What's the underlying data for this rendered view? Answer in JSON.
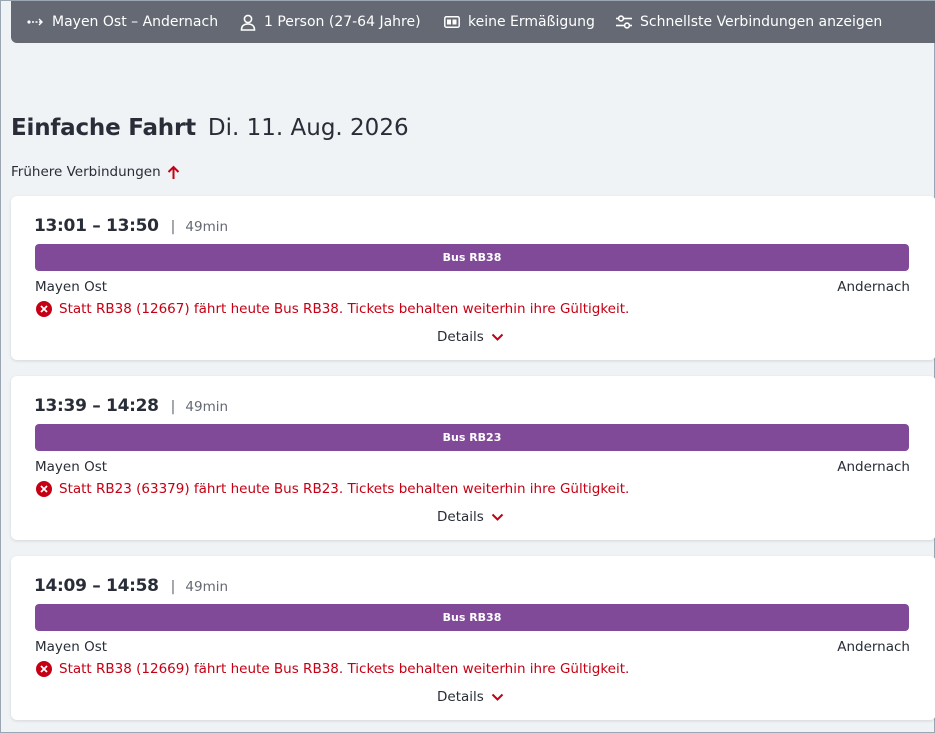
{
  "topbar": {
    "route": "Mayen Ost – Andernach",
    "travellers": "1 Person (27-64 Jahre)",
    "discount": "keine Ermäßigung",
    "filter": "Schnellste Verbindungen anzeigen"
  },
  "title": {
    "main": "Einfache Fahrt",
    "date": "Di. 11. Aug. 2026"
  },
  "earlier_label": "Frühere Verbindungen",
  "colors": {
    "accent_red": "#c50014",
    "bus_purple": "#814a98",
    "topbar_grey": "#646973"
  },
  "connections": [
    {
      "time_range": "13:01 – 13:50",
      "separator": "|",
      "duration": "49min",
      "line": "Bus RB38",
      "from": "Mayen Ost",
      "to": "Andernach",
      "notice": "Statt RB38 (12667) fährt heute Bus RB38. Tickets behalten weiterhin ihre Gültigkeit.",
      "details_label": "Details"
    },
    {
      "time_range": "13:39 – 14:28",
      "separator": "|",
      "duration": "49min",
      "line": "Bus RB23",
      "from": "Mayen Ost",
      "to": "Andernach",
      "notice": "Statt RB23 (63379) fährt heute Bus RB23. Tickets behalten weiterhin ihre Gültigkeit.",
      "details_label": "Details"
    },
    {
      "time_range": "14:09 – 14:58",
      "separator": "|",
      "duration": "49min",
      "line": "Bus RB38",
      "from": "Mayen Ost",
      "to": "Andernach",
      "notice": "Statt RB38 (12669) fährt heute Bus RB38. Tickets behalten weiterhin ihre Gültigkeit.",
      "details_label": "Details"
    }
  ]
}
